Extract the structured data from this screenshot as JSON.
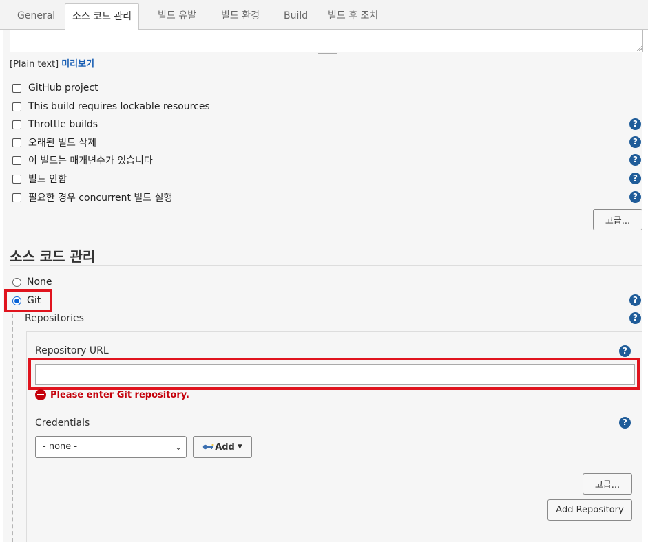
{
  "tabs": [
    "General",
    "소스 코드 관리",
    "빌드 유발",
    "빌드 환경",
    "Build",
    "빌드 후 조치"
  ],
  "description": {
    "plain_text_label": "[Plain text]",
    "preview_link": "미리보기"
  },
  "options": [
    "GitHub project",
    "This build requires lockable resources",
    "Throttle builds",
    "오래된 빌드 삭제",
    "이 빌드는 매개변수가 있습니다",
    "빌드 안함",
    "필요한 경우 concurrent 빌드 실행"
  ],
  "advanced_button": "고급...",
  "scm": {
    "title": "소스 코드 관리",
    "none_label": "None",
    "git_label": "Git",
    "selected": "Git",
    "repositories_label": "Repositories",
    "repo_url_label": "Repository URL",
    "repo_url_value": "",
    "error_text": "Please enter Git repository.",
    "credentials_label": "Credentials",
    "credentials_value": "- none -",
    "add_button": "Add",
    "advanced_button": "고급...",
    "add_repository_button": "Add Repository"
  },
  "help_glyph": "?",
  "colors": {
    "accent": "#1f5c99",
    "error": "#c4000a",
    "highlight": "#e0141e",
    "radio": "#0a64d8"
  }
}
